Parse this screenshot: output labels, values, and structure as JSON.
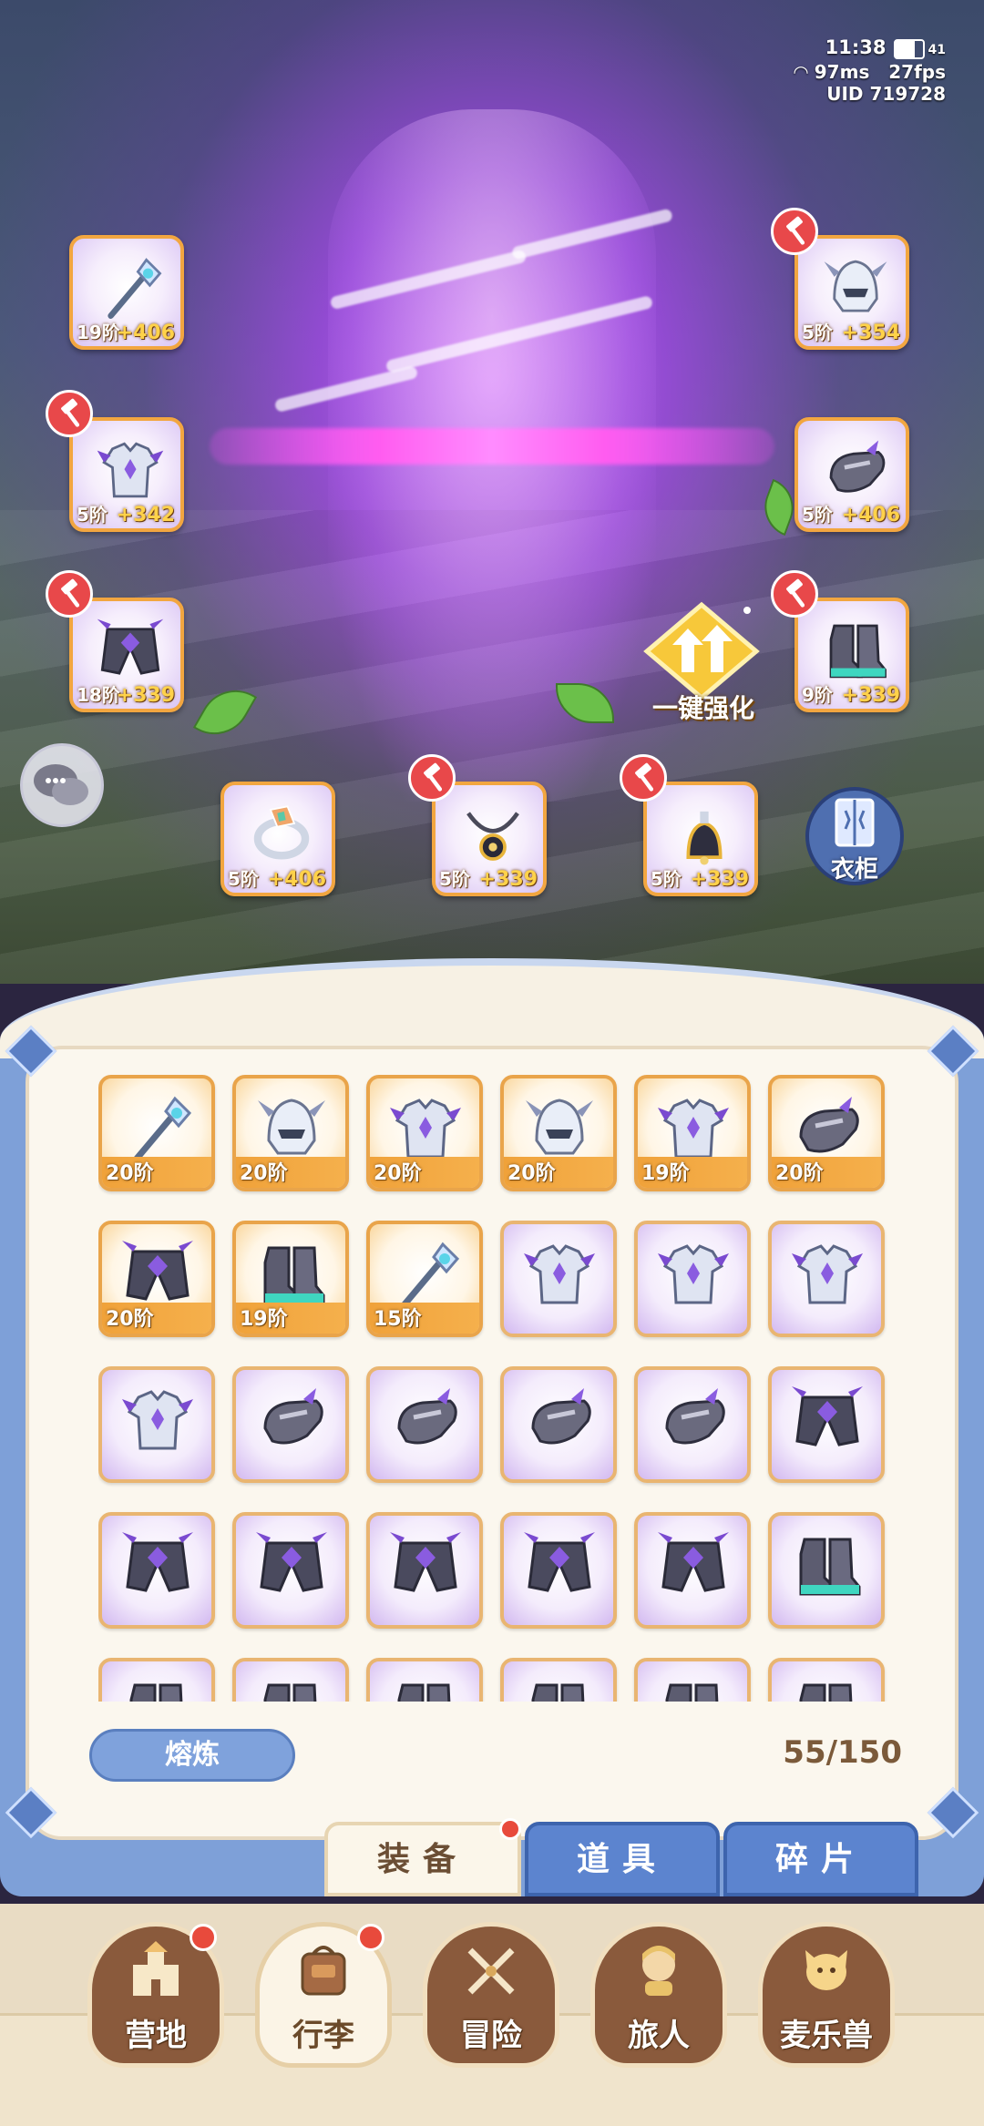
{
  "status": {
    "time": "11:38",
    "battery_label": "41",
    "ping": "97ms",
    "fps": "27fps",
    "uid": "UID 719728"
  },
  "equipped": [
    {
      "id": "weapon",
      "level": "19阶",
      "bonus": "+406",
      "hammer": false,
      "icon": "scepter-icon"
    },
    {
      "id": "helmet",
      "level": "5阶",
      "bonus": "+354",
      "hammer": true,
      "icon": "helmet-icon"
    },
    {
      "id": "armor",
      "level": "5阶",
      "bonus": "+342",
      "hammer": true,
      "icon": "armor-icon"
    },
    {
      "id": "gloves",
      "level": "5阶",
      "bonus": "+406",
      "hammer": false,
      "icon": "gauntlet-icon"
    },
    {
      "id": "pants",
      "level": "18阶",
      "bonus": "+339",
      "hammer": true,
      "icon": "pants-icon"
    },
    {
      "id": "boots",
      "level": "9阶",
      "bonus": "+339",
      "hammer": true,
      "icon": "boots-icon"
    },
    {
      "id": "ring",
      "level": "5阶",
      "bonus": "+406",
      "hammer": false,
      "icon": "ring-icon"
    },
    {
      "id": "necklace",
      "level": "5阶",
      "bonus": "+339",
      "hammer": true,
      "icon": "necklace-icon"
    },
    {
      "id": "charm",
      "level": "5阶",
      "bonus": "+339",
      "hammer": true,
      "icon": "bell-charm-icon"
    }
  ],
  "one_click_upgrade": "一键强化",
  "wardrobe": "衣柜",
  "inventory": {
    "items": [
      {
        "icon": "scepter-icon",
        "level": "20阶",
        "quality": "orange"
      },
      {
        "icon": "helmet-icon",
        "level": "20阶",
        "quality": "orange"
      },
      {
        "icon": "armor-icon",
        "level": "20阶",
        "quality": "orange"
      },
      {
        "icon": "helmet-icon",
        "level": "20阶",
        "quality": "orange"
      },
      {
        "icon": "armor-icon",
        "level": "19阶",
        "quality": "orange"
      },
      {
        "icon": "gauntlet-icon",
        "level": "20阶",
        "quality": "orange"
      },
      {
        "icon": "pants-icon",
        "level": "20阶",
        "quality": "orange"
      },
      {
        "icon": "boots-icon",
        "level": "19阶",
        "quality": "orange"
      },
      {
        "icon": "scepter-icon",
        "level": "15阶",
        "quality": "orange"
      },
      {
        "icon": "armor-icon",
        "level": "",
        "quality": "purple"
      },
      {
        "icon": "armor-icon",
        "level": "",
        "quality": "purple"
      },
      {
        "icon": "armor-icon",
        "level": "",
        "quality": "purple"
      },
      {
        "icon": "armor-icon",
        "level": "",
        "quality": "purple"
      },
      {
        "icon": "gauntlet-icon",
        "level": "",
        "quality": "purple"
      },
      {
        "icon": "gauntlet-icon",
        "level": "",
        "quality": "purple"
      },
      {
        "icon": "gauntlet-icon",
        "level": "",
        "quality": "purple"
      },
      {
        "icon": "gauntlet-icon",
        "level": "",
        "quality": "purple"
      },
      {
        "icon": "pants-icon",
        "level": "",
        "quality": "purple"
      },
      {
        "icon": "pants-icon",
        "level": "",
        "quality": "purple"
      },
      {
        "icon": "pants-icon",
        "level": "",
        "quality": "purple"
      },
      {
        "icon": "pants-icon",
        "level": "",
        "quality": "purple"
      },
      {
        "icon": "pants-icon",
        "level": "",
        "quality": "purple"
      },
      {
        "icon": "pants-icon",
        "level": "",
        "quality": "purple"
      },
      {
        "icon": "boots-icon",
        "level": "",
        "quality": "purple"
      },
      {
        "icon": "boots-icon",
        "level": "",
        "quality": "purple"
      },
      {
        "icon": "boots-icon",
        "level": "",
        "quality": "purple"
      },
      {
        "icon": "boots-icon",
        "level": "",
        "quality": "purple"
      },
      {
        "icon": "boots-icon",
        "level": "",
        "quality": "purple"
      },
      {
        "icon": "boots-icon",
        "level": "",
        "quality": "purple"
      },
      {
        "icon": "boots-icon",
        "level": "",
        "quality": "purple"
      }
    ],
    "smelt_button": "熔炼",
    "capacity": "55/150"
  },
  "tabs": [
    {
      "label": "装备",
      "active": true,
      "badge": true
    },
    {
      "label": "道具",
      "active": false,
      "badge": false
    },
    {
      "label": "碎片",
      "active": false,
      "badge": false
    }
  ],
  "nav": [
    {
      "label": "营地",
      "icon": "castle-icon",
      "active": false,
      "badge": true
    },
    {
      "label": "行李",
      "icon": "backpack-icon",
      "active": true,
      "badge": true
    },
    {
      "label": "冒险",
      "icon": "crossed-swords-icon",
      "active": false,
      "badge": false
    },
    {
      "label": "旅人",
      "icon": "traveler-icon",
      "active": false,
      "badge": false
    },
    {
      "label": "麦乐兽",
      "icon": "fox-pet-icon",
      "active": false,
      "badge": false
    }
  ],
  "colors": {
    "accent_orange": "#f0a23a",
    "panel_blue": "#7ea0d8",
    "hammer_red": "#e8484a",
    "bonus_yellow": "#ffd24a"
  }
}
